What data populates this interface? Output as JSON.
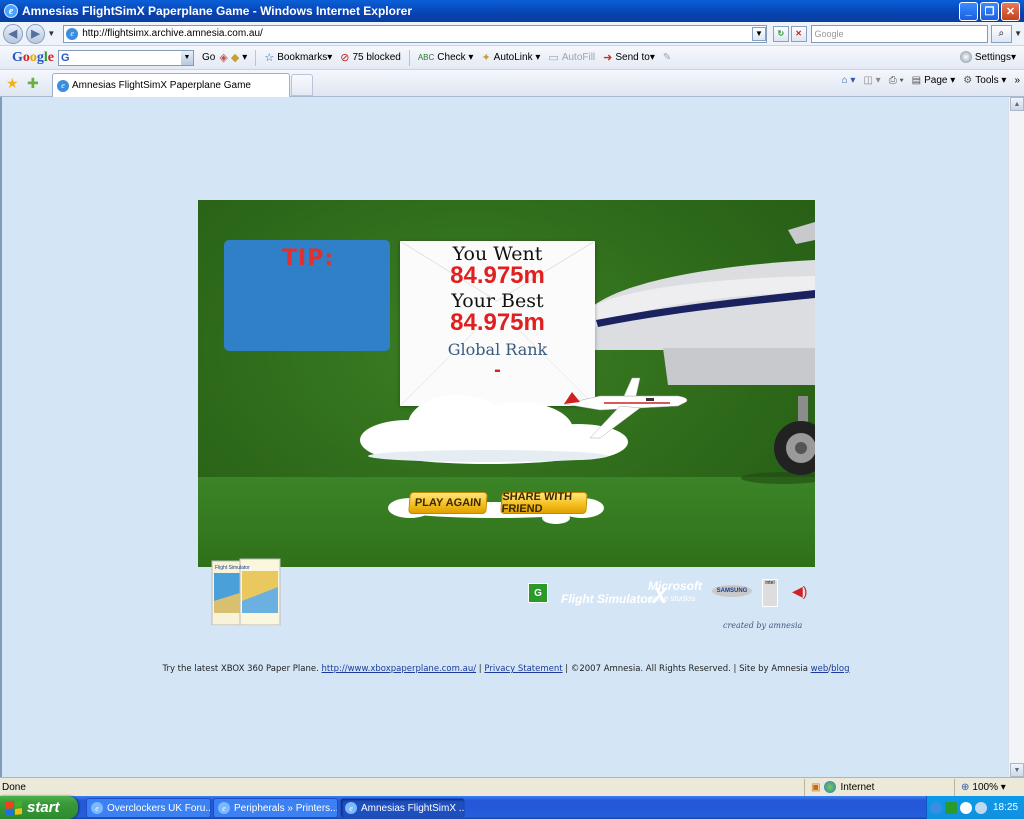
{
  "window": {
    "title": "Amnesias FlightSimX Paperplane Game - Windows Internet Explorer",
    "controls": {
      "minimize": "_",
      "maximize": "❐",
      "close": "✕"
    }
  },
  "address": {
    "url": "http://flightsimx.archive.amnesia.com.au/",
    "search_placeholder": "Google"
  },
  "google_toolbar": {
    "logo": "Google",
    "search_value": "G",
    "go": "Go",
    "bookmarks": "Bookmarks",
    "blocked": "75 blocked",
    "check": "Check",
    "autolink": "AutoLink",
    "autofill": "AutoFill",
    "send_to": "Send to",
    "settings": "Settings"
  },
  "tabs": {
    "active_tab": "Amnesias FlightSimX Paperplane Game",
    "page_menu": "Page",
    "tools_menu": "Tools"
  },
  "game": {
    "tip_label": "TIP:",
    "you_went_label": "You Went",
    "you_went_value": "84.975m",
    "your_best_label": "Your Best",
    "your_best_value": "84.975m",
    "global_rank_label": "Global Rank",
    "global_rank_value": "-",
    "play_again": "PLAY AGAIN",
    "share_with_friend": "SHARE WITH FRIEND",
    "rating": "G",
    "flight_sim_brand": "Flight Simulator",
    "flight_sim_x": "X",
    "microsoft_brand": "Microsoft",
    "game_studios": "game studios",
    "samsung": "SAMSUNG",
    "intel": "intel",
    "credit": "created by amnesia",
    "box_title": "Flight Simulator"
  },
  "footer": {
    "prefix": "Try the latest XBOX 360 Paper Plane.",
    "xbox_link": "http://www.xboxpaperplane.com.au/",
    "privacy": "Privacy Statement",
    "copyright": "©2007 Amnesia. All Rights Reserved.",
    "site_by": "Site by Amnesia",
    "web_link": "web",
    "blog_link": "blog"
  },
  "status": {
    "text": "Done",
    "zone": "Internet",
    "zoom": "100%"
  },
  "taskbar": {
    "start": "start",
    "tasks": [
      "Overclockers UK Foru...",
      "Peripherals » Printers...",
      "Amnesias FlightSimX ..."
    ],
    "clock": "18:25"
  },
  "colors": {
    "title_bar": "#0842b0",
    "page_bg": "#d4e6f6",
    "game_green": "#2e6a1a",
    "tip_blue": "#3080c8",
    "score_red": "#e02020",
    "button_yellow": "#f5c020"
  }
}
